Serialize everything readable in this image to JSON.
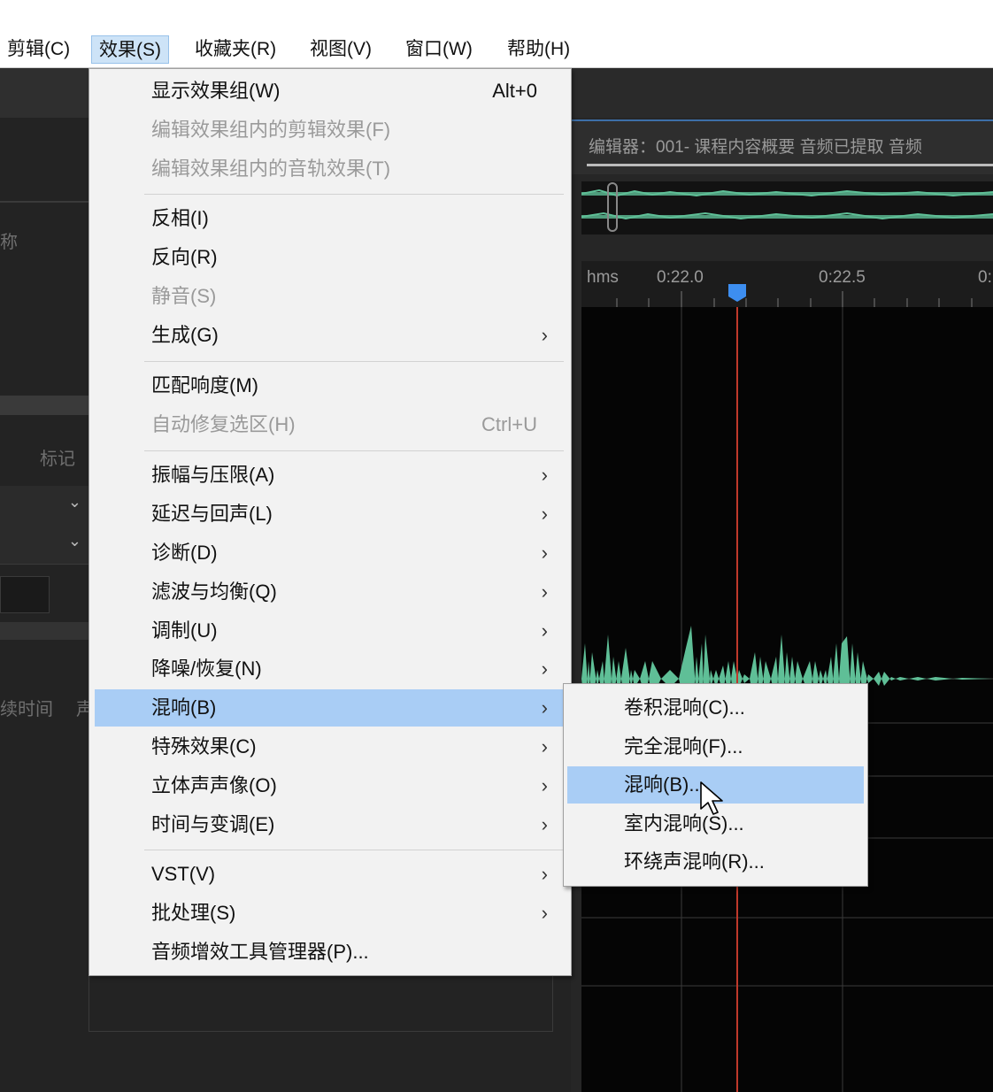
{
  "menubar": {
    "items": [
      {
        "label": "剪辑(C)"
      },
      {
        "label": "效果(S)"
      },
      {
        "label": "收藏夹(R)"
      },
      {
        "label": "视图(V)"
      },
      {
        "label": "窗口(W)"
      },
      {
        "label": "帮助(H)"
      }
    ],
    "active_index": 1
  },
  "left_panel": {
    "name_fragment": "称",
    "markers_label": "标记",
    "duration_fragment": "续时间",
    "channel_fragment": "声"
  },
  "editor": {
    "title": "编辑器：001- 课程内容概要 音频已提取 音频",
    "ruler": {
      "unit": "hms",
      "ticks": [
        "0:22.0",
        "0:22.5",
        "0:"
      ]
    }
  },
  "effects_menu": {
    "items": [
      {
        "label": "显示效果组(W)",
        "shortcut": "Alt+0",
        "enabled": true,
        "submenu": false
      },
      {
        "label": "编辑效果组内的剪辑效果(F)",
        "shortcut": "",
        "enabled": false,
        "submenu": false
      },
      {
        "label": "编辑效果组内的音轨效果(T)",
        "shortcut": "",
        "enabled": false,
        "submenu": false
      },
      {
        "label": "反相(I)",
        "shortcut": "",
        "enabled": true,
        "submenu": false
      },
      {
        "label": "反向(R)",
        "shortcut": "",
        "enabled": true,
        "submenu": false
      },
      {
        "label": "静音(S)",
        "shortcut": "",
        "enabled": false,
        "submenu": false
      },
      {
        "label": "生成(G)",
        "shortcut": "",
        "enabled": true,
        "submenu": true
      },
      {
        "label": "匹配响度(M)",
        "shortcut": "",
        "enabled": true,
        "submenu": false
      },
      {
        "label": "自动修复选区(H)",
        "shortcut": "Ctrl+U",
        "enabled": false,
        "submenu": false
      },
      {
        "label": "振幅与压限(A)",
        "shortcut": "",
        "enabled": true,
        "submenu": true
      },
      {
        "label": "延迟与回声(L)",
        "shortcut": "",
        "enabled": true,
        "submenu": true
      },
      {
        "label": "诊断(D)",
        "shortcut": "",
        "enabled": true,
        "submenu": true
      },
      {
        "label": "滤波与均衡(Q)",
        "shortcut": "",
        "enabled": true,
        "submenu": true
      },
      {
        "label": "调制(U)",
        "shortcut": "",
        "enabled": true,
        "submenu": true
      },
      {
        "label": "降噪/恢复(N)",
        "shortcut": "",
        "enabled": true,
        "submenu": true
      },
      {
        "label": "混响(B)",
        "shortcut": "",
        "enabled": true,
        "submenu": true,
        "highlighted": true
      },
      {
        "label": "特殊效果(C)",
        "shortcut": "",
        "enabled": true,
        "submenu": true
      },
      {
        "label": "立体声声像(O)",
        "shortcut": "",
        "enabled": true,
        "submenu": true
      },
      {
        "label": "时间与变调(E)",
        "shortcut": "",
        "enabled": true,
        "submenu": true
      },
      {
        "label": "VST(V)",
        "shortcut": "",
        "enabled": true,
        "submenu": true
      },
      {
        "label": "批处理(S)",
        "shortcut": "",
        "enabled": true,
        "submenu": true
      },
      {
        "label": "音频增效工具管理器(P)...",
        "shortcut": "",
        "enabled": true,
        "submenu": false
      }
    ],
    "submenu_glyph": "›"
  },
  "reverb_submenu": {
    "items": [
      {
        "label": "卷积混响(C)..."
      },
      {
        "label": "完全混响(F)..."
      },
      {
        "label": "混响(B)...",
        "highlighted": true
      },
      {
        "label": "室内混响(S)..."
      },
      {
        "label": "环绕声混响(R)..."
      }
    ]
  },
  "colors": {
    "menu_bg": "#f2f2f2",
    "menu_highlight": "#a9cdf5",
    "waveform": "#5fbf97",
    "playhead": "#c0392b",
    "playhead_marker": "#3d8ef0"
  }
}
